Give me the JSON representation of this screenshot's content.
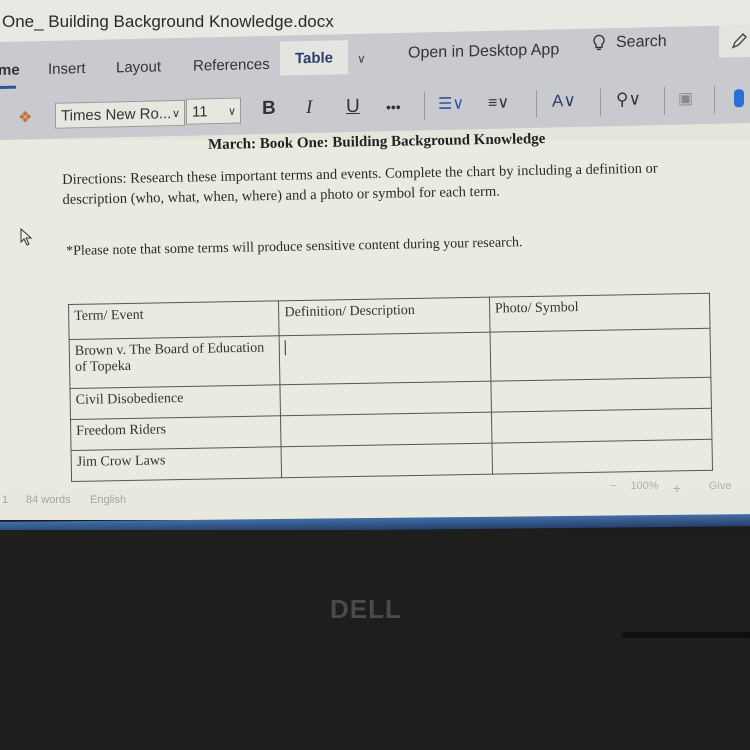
{
  "window": {
    "doc_title": "One_ Building Background Knowledge.docx"
  },
  "ribbon": {
    "tabs": [
      {
        "label": "me",
        "state": "active"
      },
      {
        "label": "Insert"
      },
      {
        "label": "Layout"
      },
      {
        "label": "References"
      },
      {
        "label": "Table",
        "state": "highlighted"
      }
    ],
    "more_tabs_icon": "chevron-down-icon",
    "open_desktop_label": "Open in Desktop App",
    "search_label": "Search",
    "search_icon": "lightbulb-icon",
    "edit_icon": "pencil-icon"
  },
  "toolbar": {
    "format_painter_icon": "paintbrush-icon",
    "font_name": "Times New Ro...",
    "font_size": "11",
    "bold_label": "B",
    "italic_label": "I",
    "underline_label": "U",
    "more_label": "•••",
    "bullets_icon": "bullet-list-icon",
    "align_icon": "align-text-icon",
    "styles_icon": "text-styles-icon",
    "find_icon": "find-magnifier-icon",
    "image_icon": "picture-icon",
    "dictate_icon": "microphone-icon"
  },
  "document": {
    "heading": "March: Book One: Building Background Knowledge",
    "directions": "Directions: Research these important terms and events. Complete the chart by including a definition or description (who, what, when, where) and a photo or symbol for each term.",
    "note": "*Please note that some terms will produce sensitive  content during your research.",
    "table": {
      "headers": [
        "Term/ Event",
        "Definition/ Description",
        "Photo/ Symbol"
      ],
      "rows": [
        [
          "Brown v. The Board of Education of Topeka",
          "",
          ""
        ],
        [
          "Civil Disobedience",
          "",
          ""
        ],
        [
          "Freedom Riders",
          "",
          ""
        ],
        [
          "Jim Crow Laws",
          "",
          ""
        ]
      ]
    }
  },
  "statusbar": {
    "page": "1",
    "word_count": "84 words",
    "language": "English",
    "zoom_out": "−",
    "zoom_level": "100%",
    "zoom_in": "+",
    "feedback": "Give"
  },
  "hardware": {
    "brand": "DELL"
  }
}
